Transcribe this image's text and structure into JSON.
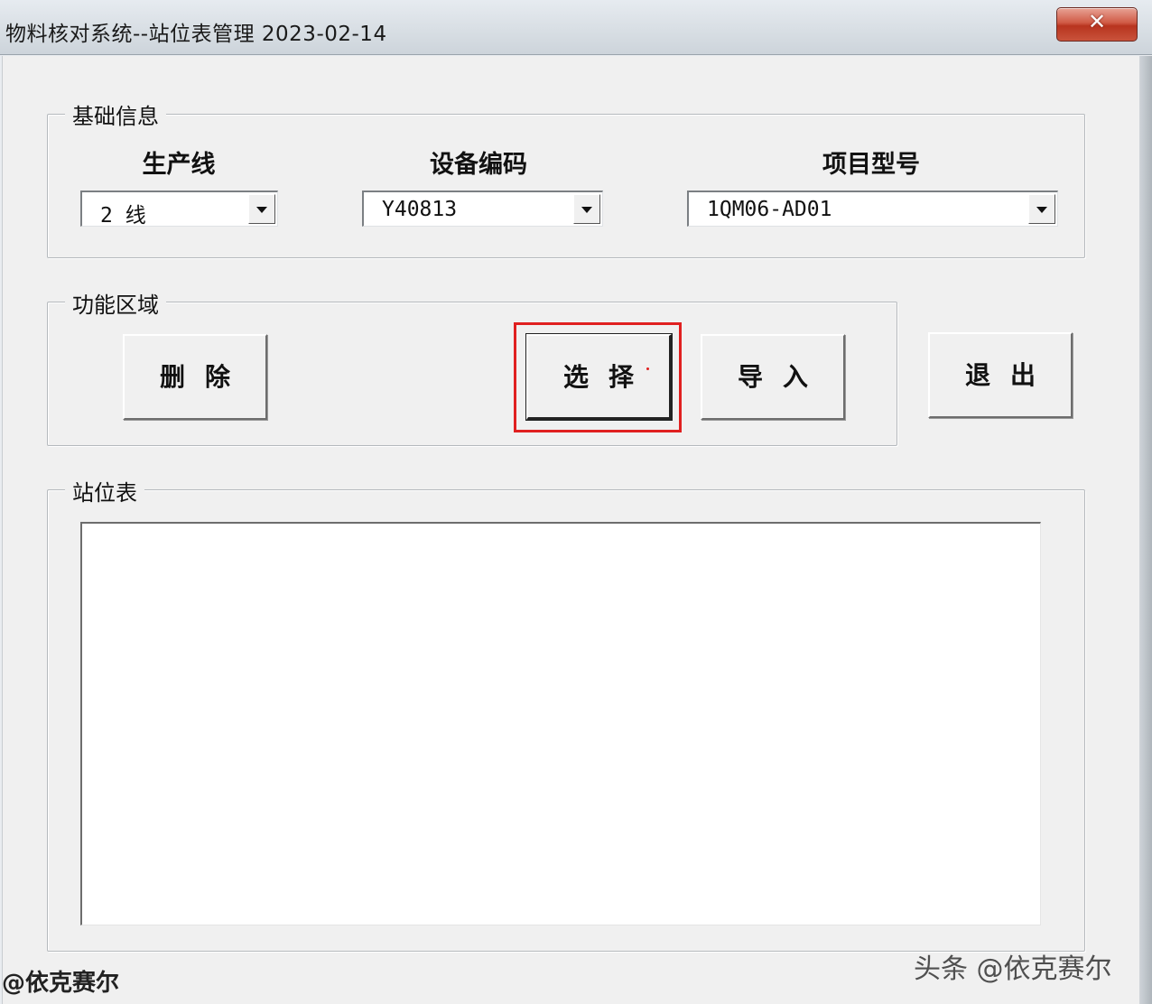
{
  "window": {
    "title": "物料核对系统--站位表管理 2023-02-14",
    "close_label": "✕"
  },
  "basic_info": {
    "group_label": "基础信息",
    "production_line": {
      "label": "生产线",
      "value": "2 线"
    },
    "device_code": {
      "label": "设备编码",
      "value": "Y40813"
    },
    "project_model": {
      "label": "项目型号",
      "value": "1QM06-AD01"
    }
  },
  "function_area": {
    "group_label": "功能区域",
    "delete_label": "删除",
    "select_label": "选择",
    "import_label": "导入"
  },
  "exit_label": "退出",
  "station_table": {
    "group_label": "站位表"
  },
  "watermarks": {
    "left": "@依克赛尔",
    "right": "头条 @依克赛尔"
  },
  "colors": {
    "highlight": "#e02020",
    "close_button": "#c9533b"
  }
}
